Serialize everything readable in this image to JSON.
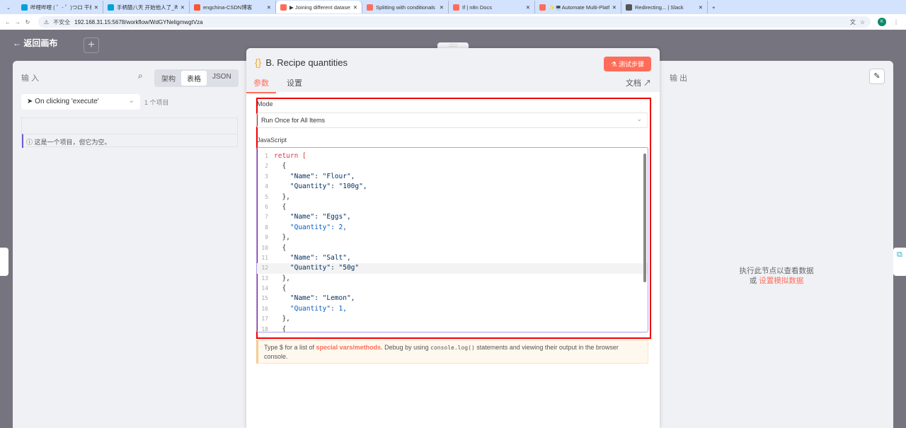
{
  "browser": {
    "tabs": [
      {
        "title": "哔哩哔哩 ( ゜- ゜)つロ 干杯~-bi",
        "color": "#00a1d6"
      },
      {
        "title": "手柄猿八天 开始他人了_哔哩哔",
        "color": "#00a1d6"
      },
      {
        "title": "engchina-CSDN博客",
        "color": "#fc5531"
      },
      {
        "title": "▶ Joining different datasets",
        "color": "#ff6d5a",
        "active": true
      },
      {
        "title": "Splitting with conditionals | n",
        "color": "#ff6d5a"
      },
      {
        "title": "If | n8n Docs",
        "color": "#ff6d5a"
      },
      {
        "title": "✨💻Automate Multi-Platfo",
        "color": "#ff6d5a"
      },
      {
        "title": "Redirecting... | Slack",
        "color": "#555"
      }
    ],
    "insecure_label": "不安全",
    "url": "192.168.31.15:5678/workflow/WdGYNeligmwgtVza",
    "profile_initial": "K"
  },
  "canvas": {
    "back_label": "返回画布"
  },
  "input_panel": {
    "title": "输 入",
    "views": [
      "架构",
      "表格",
      "JSON"
    ],
    "active_view": "表格",
    "trigger": "On clicking 'execute'",
    "item_count": "1 个项目",
    "empty_message": "这是一个项目，但它为空。"
  },
  "node": {
    "title": "B. Recipe quantities",
    "test_button": "测试步骤",
    "tabs": [
      "参数",
      "设置"
    ],
    "docs_label": "文档",
    "mode_label": "Mode",
    "mode_value": "Run Once for All Items",
    "code_label": "JavaScript",
    "code_lines": [
      "return [",
      "  {",
      "    \"Name\": \"Flour\",",
      "    \"Quantity\": \"100g\",",
      "  },",
      "  {",
      "    \"Name\": \"Eggs\",",
      "    \"Quantity\": 2,",
      "  },",
      "  {",
      "    \"Name\": \"Salt\",",
      "    \"Quantity\": \"50g\"",
      "  },",
      "  {",
      "    \"Name\": \"Lemon\",",
      "    \"Quantity\": 1,",
      "  },",
      "  {"
    ],
    "current_line": 12,
    "hint": {
      "pre": "Type $ for a list of ",
      "link": "special vars/methods",
      "mid": ". Debug by using ",
      "code": "console.log()",
      "post": " statements and viewing their output in the browser console."
    }
  },
  "output_panel": {
    "title": "输 出",
    "empty_line1": "执行此节点以查看数据",
    "or": "或",
    "mock_link": "设置模拟数据"
  },
  "colors": {
    "accent": "#ff6d5a",
    "editor_border": "#a99ef0",
    "highlight_box": "#e00000"
  }
}
